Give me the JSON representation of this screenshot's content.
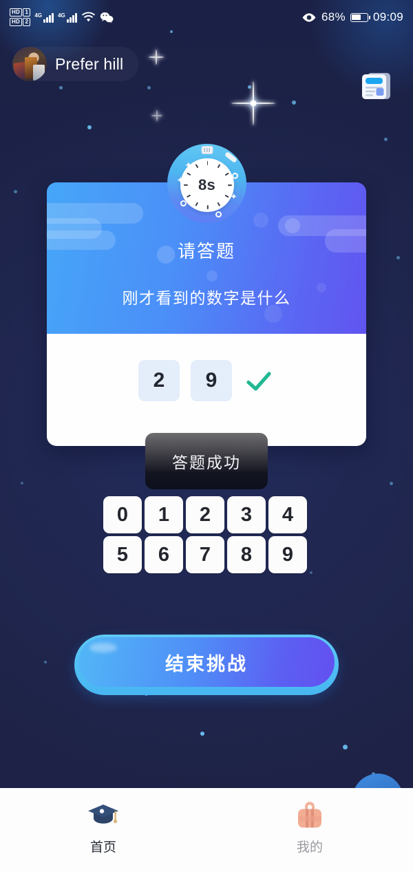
{
  "status_bar": {
    "hd1_label": "HD",
    "hd1_num": "1",
    "hd2_label": "HD",
    "hd2_num": "2",
    "net1": "4G",
    "net2": "4G",
    "wifi_icon": "wifi-icon",
    "wechat_icon": "wechat-icon",
    "eye_icon": "eye-icon",
    "battery_percent": "68%",
    "battery_icon": "battery-icon",
    "time": "09:09"
  },
  "header": {
    "avatar": "user-avatar",
    "user_name": "Prefer hill",
    "news_icon": "news-card-icon"
  },
  "timer": {
    "icon": "stopwatch-icon",
    "value": "8s"
  },
  "card": {
    "title": "请答题",
    "subtitle": "刚才看到的数字是什么",
    "answer_digits": [
      "2",
      "9"
    ],
    "result_icon": "checkmark-icon",
    "check_color": "#22b892"
  },
  "toast": {
    "message": "答题成功"
  },
  "keypad": {
    "keys": [
      "0",
      "1",
      "2",
      "3",
      "4",
      "5",
      "6",
      "7",
      "8",
      "9"
    ]
  },
  "primary_action": {
    "label": "结束挑战"
  },
  "bottom_nav": {
    "items": [
      {
        "label": "首页",
        "icon": "graduation-cap-icon",
        "active": true
      },
      {
        "label": "我的",
        "icon": "briefcase-icon",
        "active": false
      }
    ]
  },
  "theme": {
    "background": "#1e2245",
    "card_gradient_start": "#46a6f8",
    "card_gradient_end": "#6154f0",
    "accent_blue": "#4f8ef7",
    "accent_cyan": "#52b7f7",
    "answer_box_bg": "#e4edfa",
    "toast_bg": "#0d0f1c"
  }
}
